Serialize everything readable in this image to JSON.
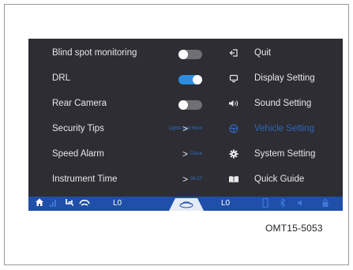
{
  "settings": [
    {
      "label": "Blind spot monitoring",
      "control": "toggle",
      "state": "off"
    },
    {
      "label": "DRL",
      "control": "toggle",
      "state": "on"
    },
    {
      "label": "Rear Camera",
      "control": "toggle",
      "state": "off"
    },
    {
      "label": "Security Tips",
      "control": "arrow",
      "value": "Lights and Horn",
      "arrow": ">"
    },
    {
      "label": "Speed Alarm",
      "control": "arrow",
      "value": "Close",
      "arrow": ">"
    },
    {
      "label": "Instrument Time",
      "control": "arrow",
      "value": "04:27",
      "arrow": ">"
    }
  ],
  "menu": [
    {
      "label": "Quit",
      "icon": "exit-icon"
    },
    {
      "label": "Display Setting",
      "icon": "display-icon"
    },
    {
      "label": "Sound Setting",
      "icon": "speaker-icon"
    },
    {
      "label": "Vehicle Setting",
      "icon": "steering-wheel-icon",
      "active": true
    },
    {
      "label": "System Setting",
      "icon": "gear-icon"
    },
    {
      "label": "Quick Guide",
      "icon": "book-icon"
    }
  ],
  "status_bar": {
    "left_level": "L0",
    "right_level": "L0"
  },
  "caption": "OMT15-5053",
  "colors": {
    "screen_bg": "#2d2d33",
    "toggle_on": "#2c8de0",
    "toggle_off": "#707074",
    "active_item": "#2f66b8",
    "status_bar": "#1f4fa8"
  }
}
